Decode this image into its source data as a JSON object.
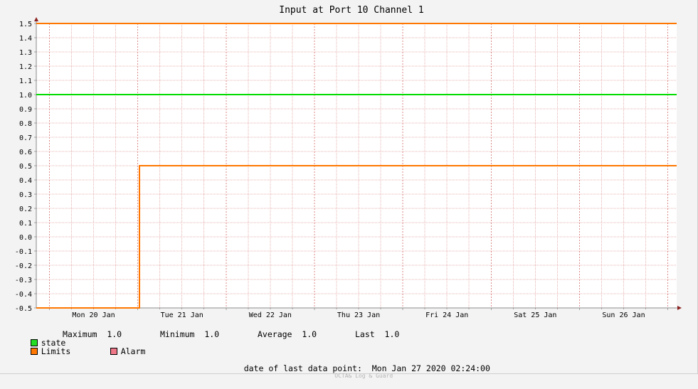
{
  "chart_data": {
    "type": "line",
    "title": "Input at Port 10 Channel 1",
    "x_tick_labels": [
      "Mon 20 Jan",
      "Tue 21 Jan",
      "Wed 22 Jan",
      "Thu 23 Jan",
      "Fri 24 Jan",
      "Sat 25 Jan",
      "Sun 26 Jan"
    ],
    "x_domain": [
      "2020-01-19T20:26",
      "2020-01-27T02:24"
    ],
    "y_ticks": [
      1.5,
      1.4,
      1.3,
      1.2,
      1.1,
      1.0,
      0.9,
      0.8,
      0.7,
      0.6,
      0.5,
      0.4,
      0.3,
      0.2,
      0.1,
      0.0,
      -0.1,
      -0.2,
      -0.3,
      -0.4,
      -0.5
    ],
    "y_tick_labels": [
      "1.5",
      "1.4",
      "1.3",
      "1.2",
      "1.1",
      "1.0",
      "0.9",
      "0.8",
      "0.7",
      "0.6",
      "0.5",
      "0.4",
      "0.3",
      "0.2",
      "0.1",
      "0.0",
      "-0.1",
      "-0.2",
      "-0.3",
      "-0.4",
      "-0.5"
    ],
    "ylim": [
      -0.5,
      1.5
    ],
    "grid": true,
    "series": [
      {
        "name": "state",
        "color": "#00dd00",
        "points": [
          [
            "2020-01-19T20:26",
            1.0
          ],
          [
            "2020-01-27T02:24",
            1.0
          ]
        ]
      },
      {
        "name": "Limits",
        "color": "#ff7700",
        "points": [
          [
            "2020-01-19T20:26",
            1.5
          ],
          [
            "2020-01-27T02:24",
            1.5
          ]
        ]
      },
      {
        "name": "Limits",
        "color": "#ff7700",
        "points": [
          [
            "2020-01-19T20:26",
            -0.5
          ],
          [
            "2020-01-21T00:30",
            -0.5
          ],
          [
            "2020-01-21T00:30",
            0.5
          ],
          [
            "2020-01-27T02:24",
            0.5
          ]
        ]
      }
    ]
  },
  "legend": {
    "state": {
      "label": "state",
      "color": "#22dd22"
    },
    "limits": {
      "label": "Limits",
      "color": "#ff7700"
    },
    "alarm": {
      "label": "Alarm",
      "color": "#ee7788"
    },
    "stats": [
      {
        "label": "Maximum",
        "value": "1.0"
      },
      {
        "label": "Minimum",
        "value": "1.0"
      },
      {
        "label": "Average",
        "value": "1.0"
      },
      {
        "label": "Last",
        "value": "1.0"
      }
    ]
  },
  "footer": {
    "last_point_label": "date of last data point:",
    "last_point_value": "Mon Jan 27 2020 02:24:00",
    "watermark": "OCTA& Log & Guard"
  }
}
